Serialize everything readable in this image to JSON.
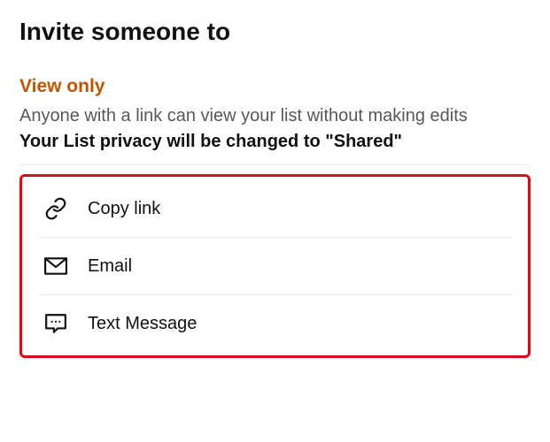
{
  "header": {
    "title": "Invite someone to"
  },
  "section": {
    "heading": "View only",
    "description": "Anyone with a link can view your list without making edits",
    "privacy_note": "Your List privacy will be changed to \"Shared\""
  },
  "share_options": {
    "copy_link": "Copy link",
    "email": "Email",
    "text_message": "Text Message"
  }
}
